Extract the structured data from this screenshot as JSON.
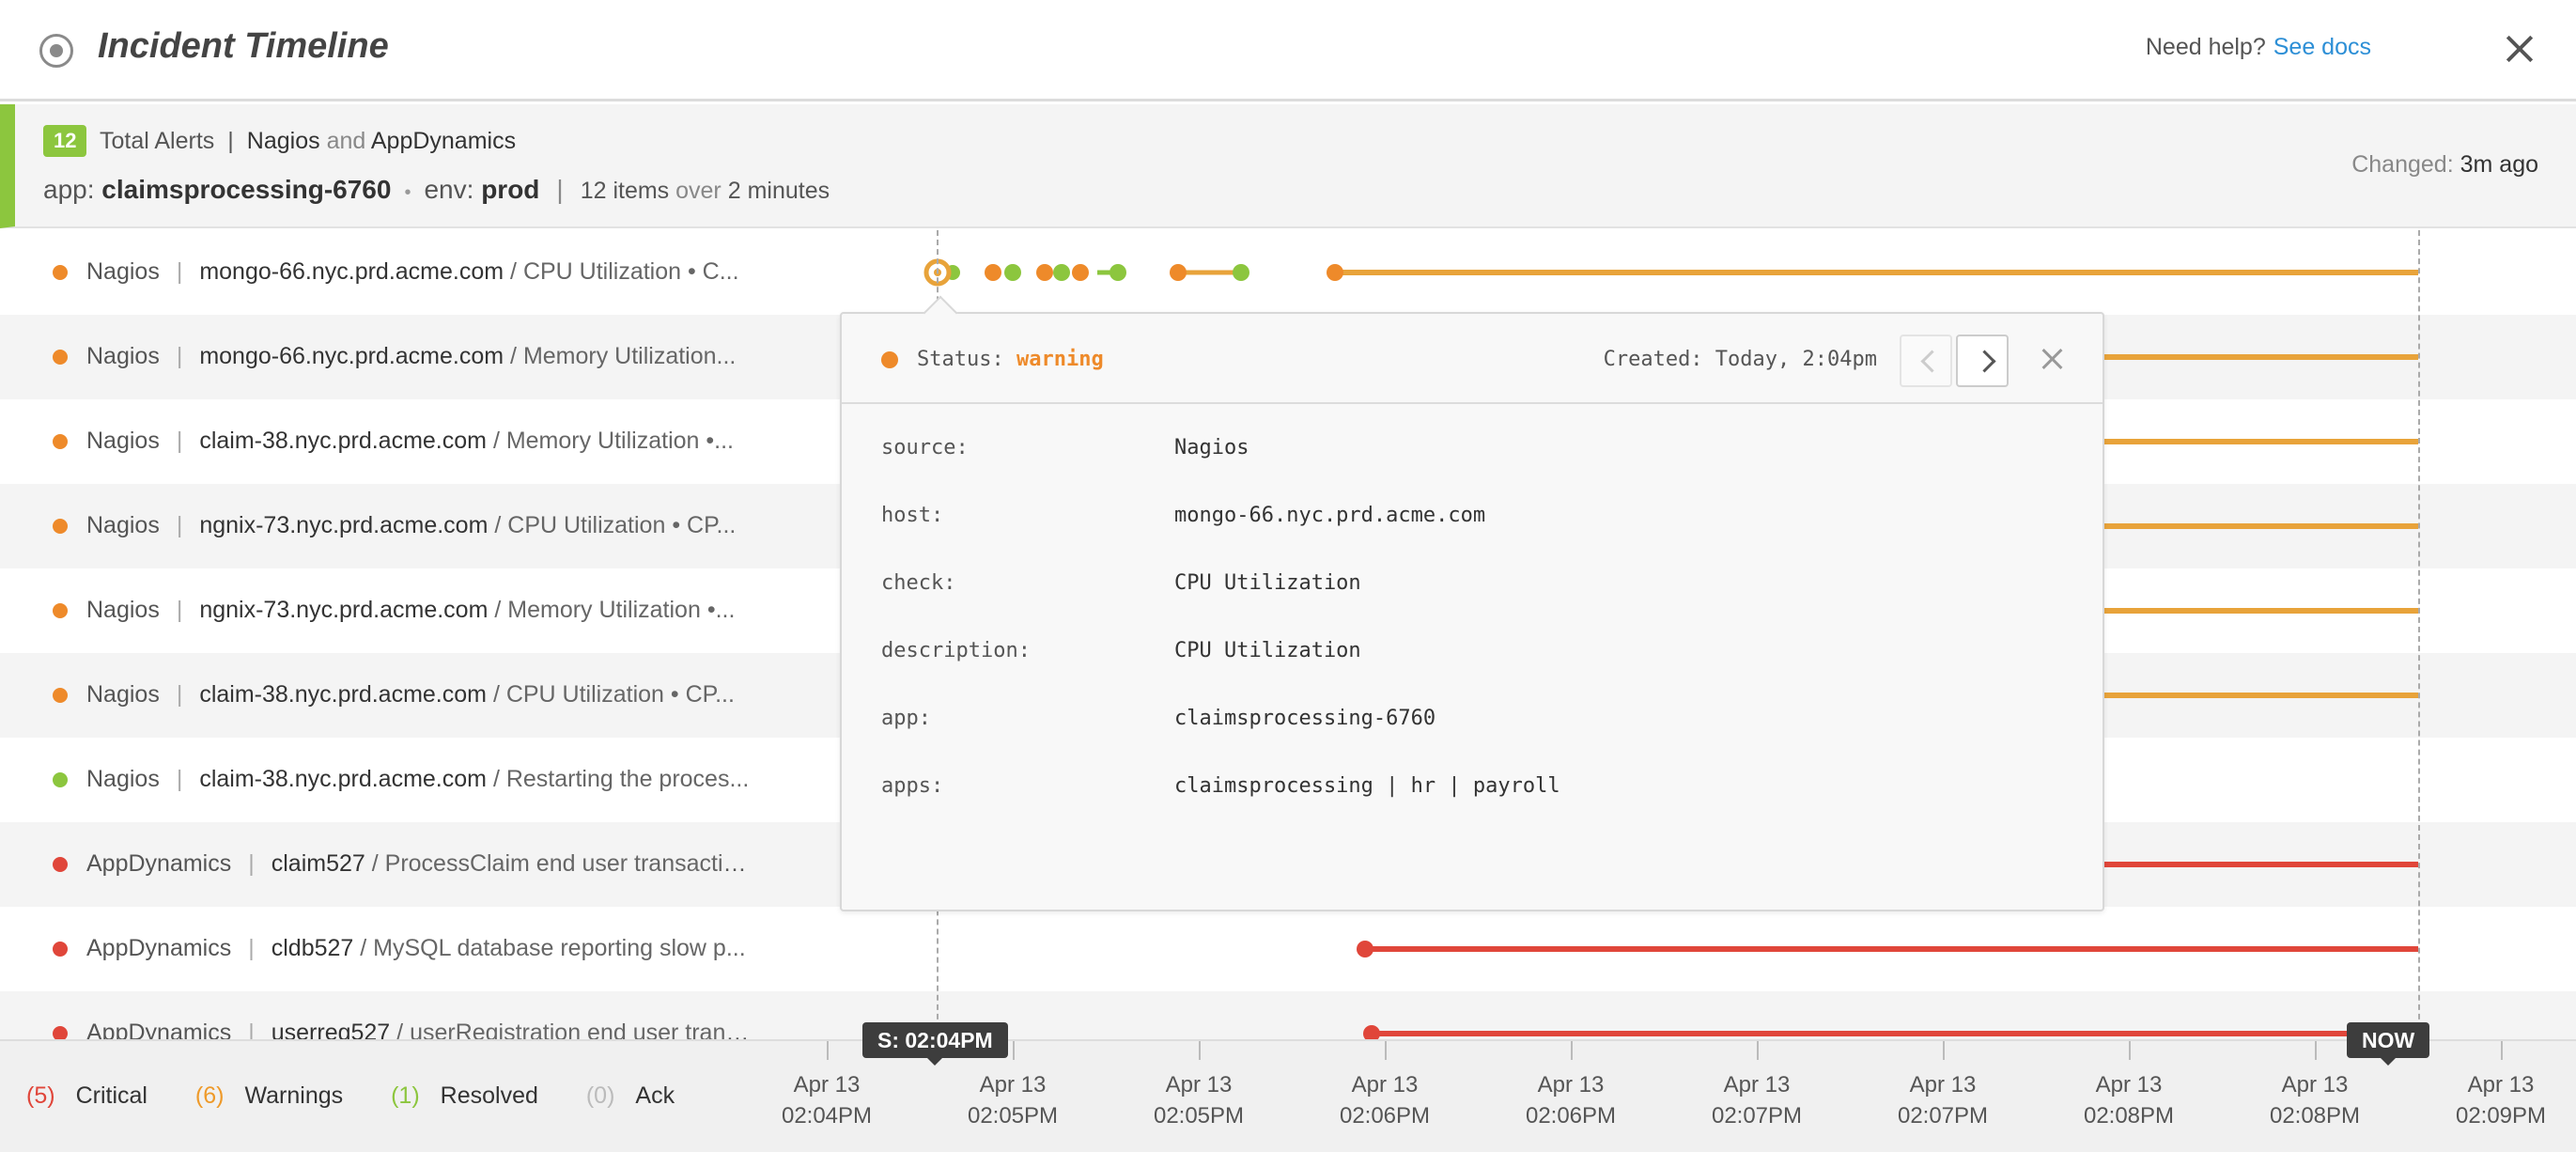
{
  "header": {
    "title": "Incident Timeline",
    "help_text": "Need help?",
    "help_link": "See docs"
  },
  "summary": {
    "total_count": "12",
    "total_label": "Total Alerts",
    "source_a": "Nagios",
    "and_word": "and",
    "source_b": "AppDynamics",
    "app_key": "app:",
    "app_value": "claimsprocessing-6760",
    "env_key": "env:",
    "env_value": "prod",
    "items": "12 items",
    "over_word": "over",
    "duration": "2 minutes",
    "changed_label": "Changed:",
    "changed_value": "3m ago"
  },
  "colors": {
    "warning": "#ee8a2a",
    "warning_line": "#e8a33a",
    "resolved": "#8cc63e",
    "critical": "#e0463a"
  },
  "rows": [
    {
      "status": "warning",
      "source": "Nagios",
      "host": "mongo-66.nyc.prd.acme.com",
      "check": "/ CPU Utilization  •  C..."
    },
    {
      "status": "warning",
      "source": "Nagios",
      "host": "mongo-66.nyc.prd.acme.com",
      "check": "/ Memory Utilization..."
    },
    {
      "status": "warning",
      "source": "Nagios",
      "host": "claim-38.nyc.prd.acme.com",
      "check": "/ Memory Utilization  •..."
    },
    {
      "status": "warning",
      "source": "Nagios",
      "host": "ngnix-73.nyc.prd.acme.com",
      "check": "/ CPU Utilization  •  CP..."
    },
    {
      "status": "warning",
      "source": "Nagios",
      "host": "ngnix-73.nyc.prd.acme.com",
      "check": "/ Memory Utilization  •..."
    },
    {
      "status": "warning",
      "source": "Nagios",
      "host": "claim-38.nyc.prd.acme.com",
      "check": "/ CPU Utilization  •  CP..."
    },
    {
      "status": "resolved",
      "source": "Nagios",
      "host": "claim-38.nyc.prd.acme.com",
      "check": "/ Restarting the proces..."
    },
    {
      "status": "critical",
      "source": "AppDynamics",
      "host": "claim527",
      "check": "/ ProcessClaim end user transactio..."
    },
    {
      "status": "critical",
      "source": "AppDynamics",
      "host": "cldb527",
      "check": "/ MySQL database reporting slow p..."
    },
    {
      "status": "critical",
      "source": "AppDynamics",
      "host": "userreg527",
      "check": "/ userRegistration end user trans..."
    }
  ],
  "popup": {
    "status_label": "Status:",
    "status_value": "warning",
    "created": "Created: Today, 2:04pm",
    "fields": [
      {
        "key": "source:",
        "value": "Nagios"
      },
      {
        "key": "host:",
        "value": "mongo-66.nyc.prd.acme.com"
      },
      {
        "key": "check:",
        "value": "CPU Utilization"
      },
      {
        "key": "description:",
        "value": "CPU Utilization"
      },
      {
        "key": "app:",
        "value": "claimsprocessing-6760"
      },
      {
        "key": "apps:",
        "value": "claimsprocessing | hr | payroll"
      }
    ]
  },
  "legend": {
    "critical_count": "(5)",
    "critical_label": "Critical",
    "warning_count": "(6)",
    "warning_label": "Warnings",
    "resolved_count": "(1)",
    "resolved_label": "Resolved",
    "ack_count": "(0)",
    "ack_label": "Ack"
  },
  "axis": {
    "ticks": [
      {
        "date": "Apr 13",
        "time": "02:04PM"
      },
      {
        "date": "Apr 13",
        "time": "02:05PM"
      },
      {
        "date": "Apr 13",
        "time": "02:05PM"
      },
      {
        "date": "Apr 13",
        "time": "02:06PM"
      },
      {
        "date": "Apr 13",
        "time": "02:06PM"
      },
      {
        "date": "Apr 13",
        "time": "02:07PM"
      },
      {
        "date": "Apr 13",
        "time": "02:07PM"
      },
      {
        "date": "Apr 13",
        "time": "02:08PM"
      },
      {
        "date": "Apr 13",
        "time": "02:08PM"
      },
      {
        "date": "Apr 13",
        "time": "02:09PM"
      }
    ],
    "start_flag": "S: 02:04PM",
    "now_flag": "NOW"
  }
}
